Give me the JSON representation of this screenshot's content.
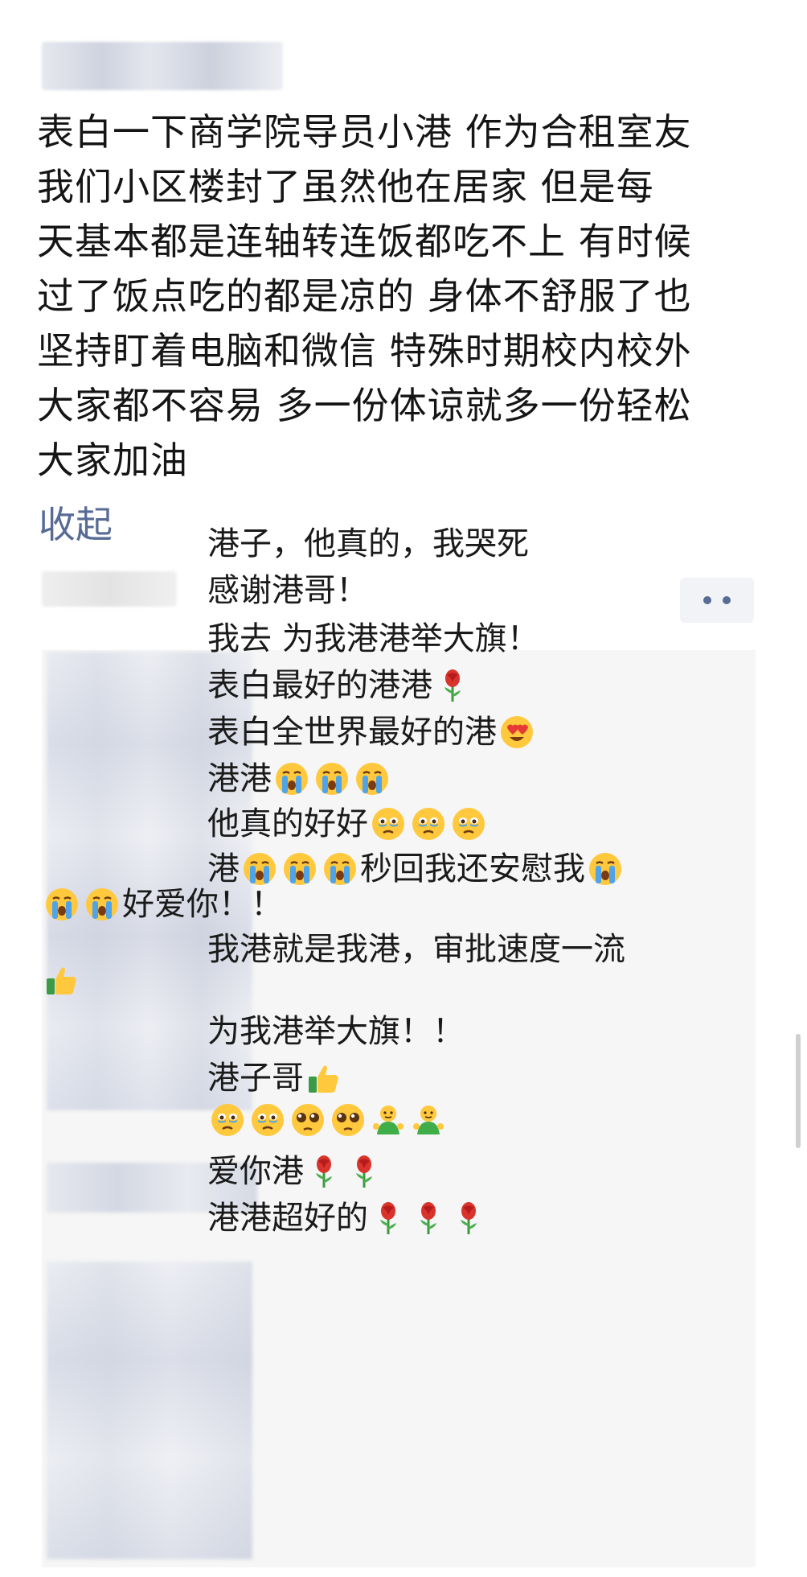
{
  "post": {
    "lines": [
      "表白一下商学院导员小港 作为合租室友",
      " 我们小区楼封了虽然他在居家 但是每",
      "天基本都是连轴转连饭都吃不上 有时候",
      "过了饭点吃的都是凉的 身体不舒服了也",
      "坚持盯着电脑和微信 特殊时期校内校外",
      "大家都不容易 多一份体谅就多一份轻松",
      " 大家加油"
    ],
    "collapse_label": "收起"
  },
  "comments": [
    {
      "segments": [
        {
          "t": "港子，他真的，我哭死"
        }
      ]
    },
    {
      "segments": [
        {
          "t": "感谢港哥！"
        }
      ]
    },
    {
      "segments": [
        {
          "t": "我去 为我港港举大旗！"
        }
      ]
    },
    {
      "segments": [
        {
          "t": "表白最好的港港"
        },
        {
          "e": "rose"
        }
      ]
    },
    {
      "segments": [
        {
          "t": "表白全世界最好的港"
        },
        {
          "e": "heart-eyes"
        }
      ]
    },
    {
      "segments": [
        {
          "t": "港港"
        },
        {
          "e": "crying"
        },
        {
          "e": "crying"
        },
        {
          "e": "crying"
        }
      ]
    },
    {
      "segments": [
        {
          "t": "他真的好好"
        },
        {
          "e": "teary"
        },
        {
          "e": "teary"
        },
        {
          "e": "teary"
        }
      ]
    },
    {
      "segments": [
        {
          "t": "港"
        },
        {
          "e": "crying"
        },
        {
          "e": "crying"
        },
        {
          "e": "crying"
        },
        {
          "t": "秒回我还安慰我"
        },
        {
          "e": "crying"
        }
      ]
    },
    {
      "segments": [
        {
          "e": "crying"
        },
        {
          "e": "crying"
        },
        {
          "t": "好爱你！！"
        }
      ]
    },
    {
      "segments": [
        {
          "t": "我港就是我港，审批速度一流"
        }
      ]
    },
    {
      "segments": [
        {
          "e": "thumbs-up"
        }
      ]
    },
    {
      "segments": [
        {
          "t": "为我港举大旗！！"
        }
      ]
    },
    {
      "segments": [
        {
          "t": "港子哥"
        },
        {
          "e": "thumbs-up"
        }
      ]
    },
    {
      "segments": [
        {
          "e": "teary"
        },
        {
          "e": "teary"
        },
        {
          "e": "pleading"
        },
        {
          "e": "pleading"
        },
        {
          "e": "strong"
        },
        {
          "e": "strong"
        }
      ]
    },
    {
      "segments": [
        {
          "t": "爱你港"
        },
        {
          "e": "rose"
        },
        {
          "e": "rose"
        }
      ]
    },
    {
      "segments": [
        {
          "t": "港港超好的"
        },
        {
          "e": "rose"
        },
        {
          "e": "rose"
        },
        {
          "e": "rose"
        }
      ]
    }
  ],
  "colors": {
    "link": "#576b95",
    "comment_bg": "#f6f6f6",
    "text": "#151515"
  }
}
